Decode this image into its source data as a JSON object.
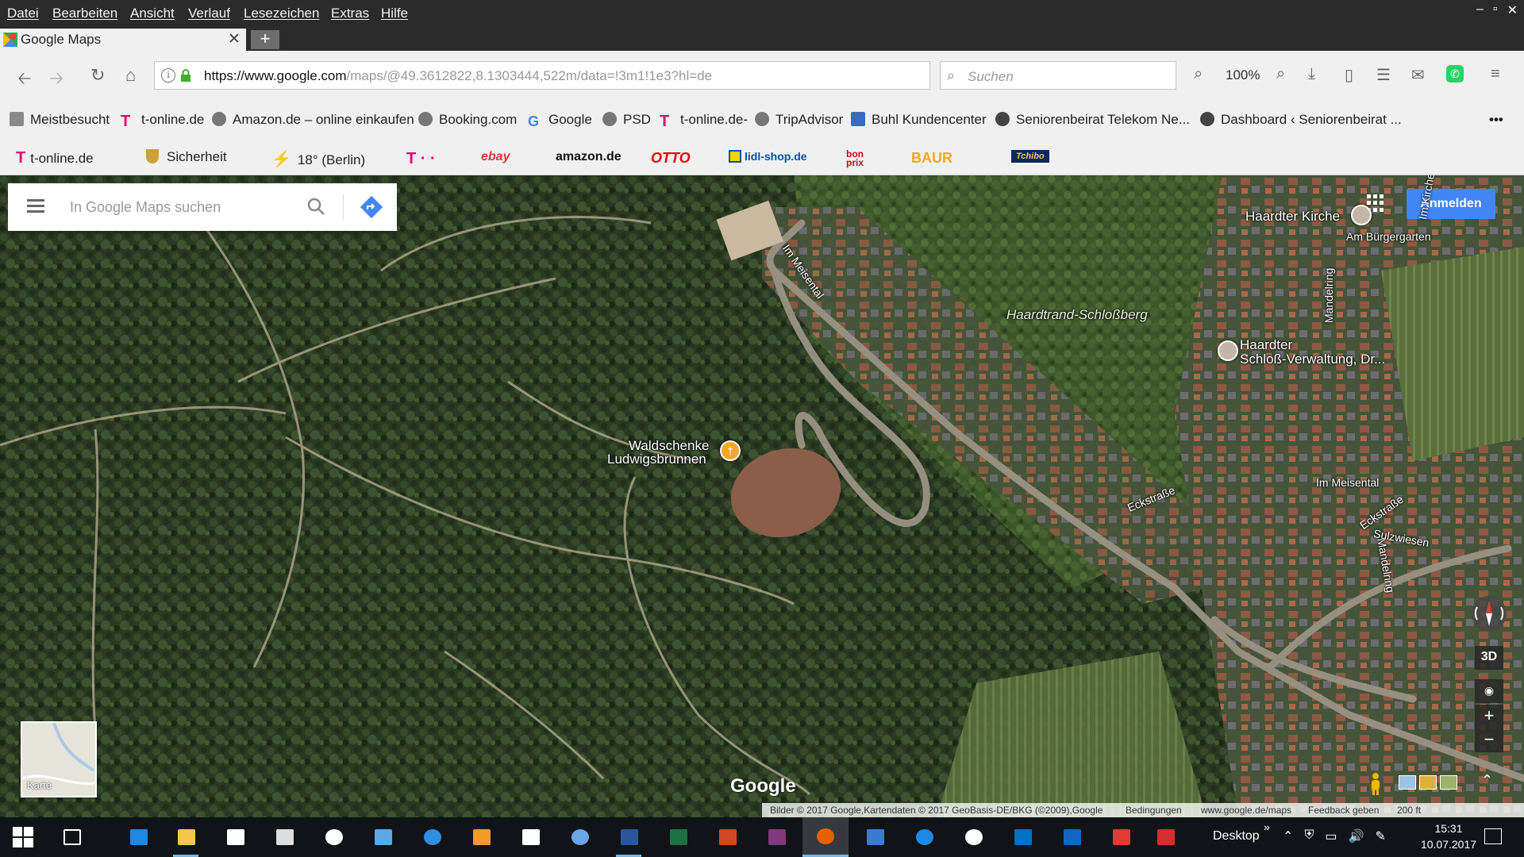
{
  "menubar": {
    "items": [
      "Datei",
      "Bearbeiten",
      "Ansicht",
      "Verlauf",
      "Lesezeichen",
      "Extras",
      "Hilfe"
    ]
  },
  "window_controls": {
    "minimize": "–",
    "maximize": "▫",
    "close": "✕"
  },
  "tab": {
    "title": "Google Maps",
    "close": "✕",
    "new_tab": "+"
  },
  "navbar": {
    "url_host": "https://www.google.com",
    "url_rest": "/maps/@49.3612822,8.1303444,522m/data=!3m1!1e3?hl=de",
    "search_placeholder": "Suchen",
    "zoom": "100%"
  },
  "bookmarks_row1": [
    {
      "label": "Meistbesucht",
      "icon": "most-visited-icon"
    },
    {
      "label": "t-online.de",
      "icon": "telekom-icon"
    },
    {
      "label": "Amazon.de – online einkaufen",
      "icon": "globe-icon"
    },
    {
      "label": "Booking.com",
      "icon": "globe-icon"
    },
    {
      "label": "Google",
      "icon": "google-icon"
    },
    {
      "label": "PSD",
      "icon": "globe-icon"
    },
    {
      "label": "t-online.de-",
      "icon": "telekom-icon"
    },
    {
      "label": "TripAdvisor",
      "icon": "globe-icon"
    },
    {
      "label": "Buhl Kundencenter",
      "icon": "page-icon"
    },
    {
      "label": "Seniorenbeirat Telekom  Ne...",
      "icon": "star-icon"
    },
    {
      "label": "Dashboard ‹ Seniorenbeirat ...",
      "icon": "star-icon"
    }
  ],
  "bookmarks_overflow": "•••",
  "bookmarks_row2": {
    "tonline": "t-online.de",
    "sicherheit": "Sicherheit",
    "weather": "18° (Berlin)",
    "telekom": "T · ·",
    "ebay": "ebay",
    "amazon": "amazon.de",
    "otto": "OTTO",
    "lidl": "lidl-shop.de",
    "bonprix": "bon prix",
    "baur": "BAUR",
    "tchibo": "Tchibo"
  },
  "map": {
    "search_placeholder": "In Google Maps suchen",
    "signin": "Anmelden",
    "places": {
      "kirche": "Haardter Kirche",
      "area": "Haardtrand-Schloßberg",
      "schloss_1": "Haardter",
      "schloss_2": "Schloß-Verwaltung, Dr...",
      "waldschenke_1": "Waldschenke",
      "waldschenke_2": "Ludwigsbrunnen"
    },
    "streets": {
      "meisental_top": "Im Meisental",
      "buergergarten": "Am Bürgergarten",
      "mandelring_1": "Mandelring",
      "mandelring_2": "Mandelring",
      "meisental_bottom": "Im Meisental",
      "eckstrasse_1": "Eckstraße",
      "eckstrasse_2": "Eckstraße",
      "sulzwiesen": "Sulzwiesen",
      "kirchen": "Im Kirchen"
    },
    "minimap_label": "Karte",
    "logo": "Google",
    "btn_3d": "3D",
    "zoom_in": "+",
    "zoom_out": "−",
    "layers_toggle": "⌃"
  },
  "footer": {
    "attribution": "Bilder © 2017 Google,Kartendaten © 2017 GeoBasis-DE/BKG (©2009),Google",
    "terms": "Bedingungen",
    "site": "www.google.de/maps",
    "feedback": "Feedback geben",
    "scale": "200 ft"
  },
  "taskbar": {
    "desktop": "Desktop",
    "chevron": "»",
    "time": "15:31",
    "date": "10.07.2017"
  },
  "colors": {
    "accent_blue": "#4285f4",
    "menubar": "#2b2b2b",
    "taskbar": "#101418",
    "restaurant_pin": "#f5a623",
    "telekom": "#e20074"
  }
}
